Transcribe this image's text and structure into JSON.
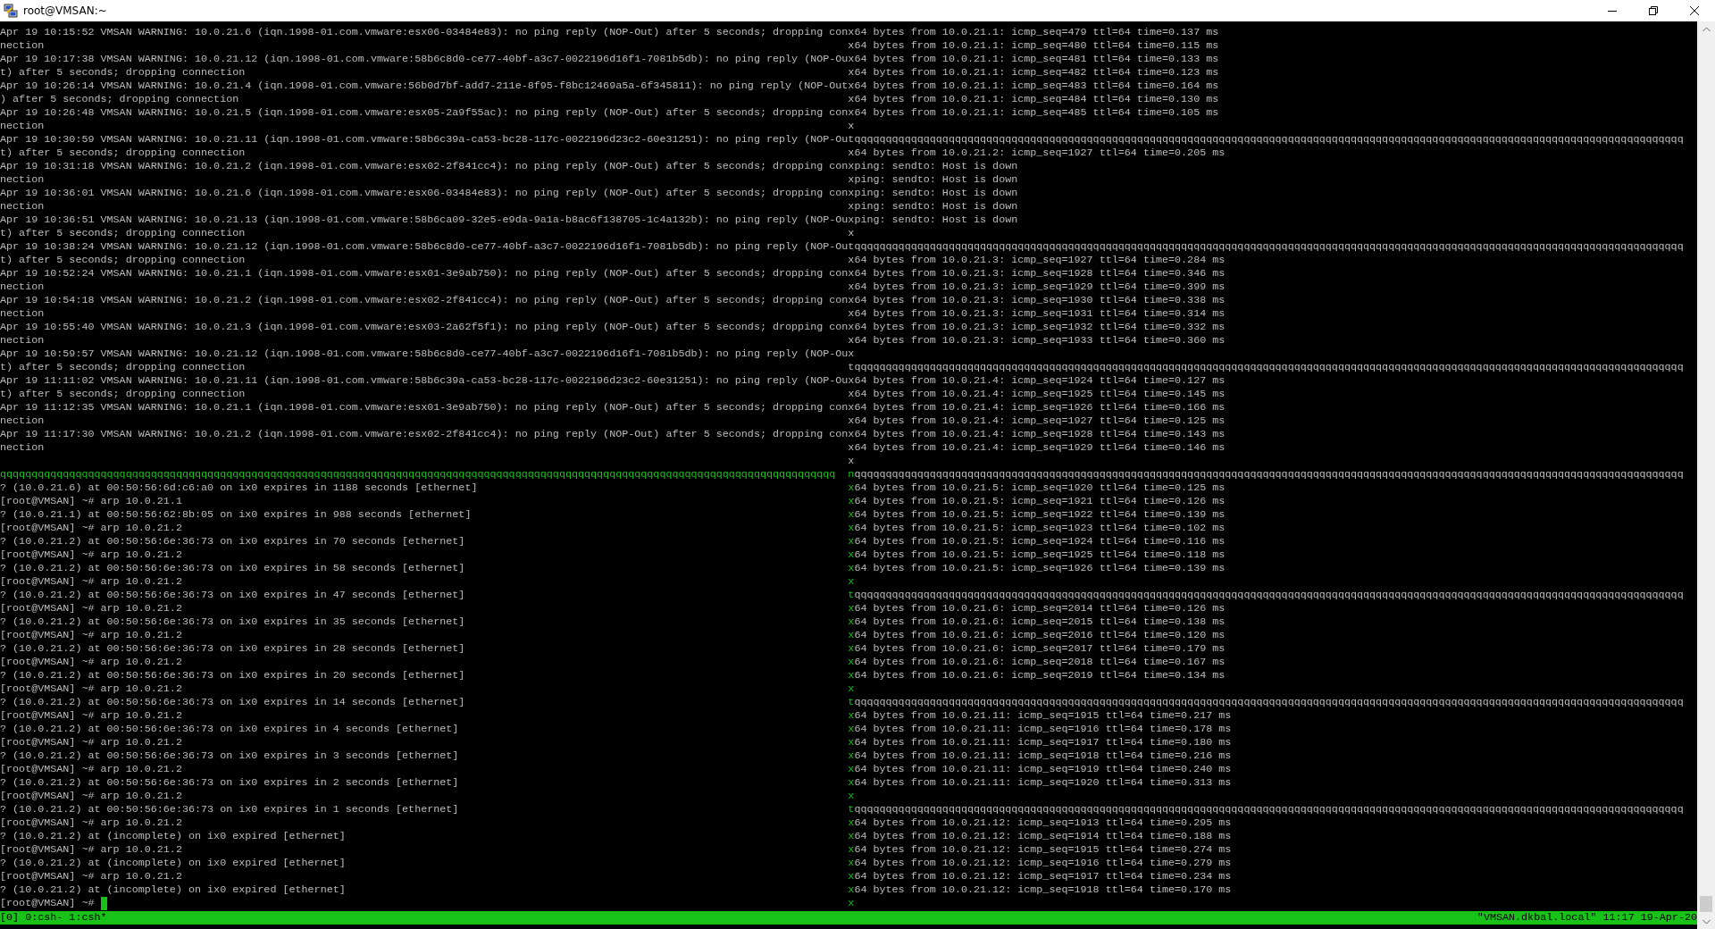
{
  "window": {
    "title": "root@VMSAN:~"
  },
  "terminal": {
    "upper_rows": {
      "active": false,
      "rows": [
        {
          "left": "Apr 19 10:15:52 VMSAN WARNING: 10.0.21.6 (iqn.1998-01.com.vmware:esx06-03484e83): no ping reply (NOP-Out) after 5 seconds; dropping con",
          "sep": "x",
          "right": "64 bytes from 10.0.21.1: icmp_seq=479 ttl=64 time=0.137 ms"
        },
        {
          "left": "nection",
          "sep": "x",
          "right": "64 bytes from 10.0.21.1: icmp_seq=480 ttl=64 time=0.115 ms"
        },
        {
          "left": "Apr 19 10:17:38 VMSAN WARNING: 10.0.21.12 (iqn.1998-01.com.vmware:58b6c8d0-ce77-40bf-a3c7-0022196d16f1-7081b5db): no ping reply (NOP-Ou",
          "sep": "x",
          "right": "64 bytes from 10.0.21.1: icmp_seq=481 ttl=64 time=0.133 ms"
        },
        {
          "left": "t) after 5 seconds; dropping connection",
          "sep": "x",
          "right": "64 bytes from 10.0.21.1: icmp_seq=482 ttl=64 time=0.123 ms"
        },
        {
          "left": "Apr 19 10:26:14 VMSAN WARNING: 10.0.21.4 (iqn.1998-01.com.vmware:56b0d7bf-add7-211e-8f95-f8bc12469a5a-6f345811): no ping reply (NOP-Out",
          "sep": "x",
          "right": "64 bytes from 10.0.21.1: icmp_seq=483 ttl=64 time=0.164 ms"
        },
        {
          "left": ") after 5 seconds; dropping connection",
          "sep": "x",
          "right": "64 bytes from 10.0.21.1: icmp_seq=484 ttl=64 time=0.130 ms"
        },
        {
          "left": "Apr 19 10:26:48 VMSAN WARNING: 10.0.21.5 (iqn.1998-01.com.vmware:esx05-2a9f55ac): no ping reply (NOP-Out) after 5 seconds; dropping con",
          "sep": "x",
          "right": "64 bytes from 10.0.21.1: icmp_seq=485 ttl=64 time=0.105 ms"
        },
        {
          "left": "nection",
          "sep": "x"
        },
        {
          "left": "Apr 19 10:30:59 VMSAN WARNING: 10.0.21.11 (iqn.1998-01.com.vmware:58b6c39a-ca53-bc28-117c-0022196d23c2-60e31251): no ping reply (NOP-Ou",
          "sep": "t",
          "right": "qqqqqqqqqqqqqqqqqqqqqqqqqqqqqqqqqqqqqqqqqqqqqqqqqqqqqqqqqqqqqqqqqqqqqqqqqqqqqqqqqqqqqqqqqqqqqqqqqqqqqqqqqqqqqqqqqqqqqqqqqqqqqqqqqqqq"
        },
        {
          "left": "t) after 5 seconds; dropping connection",
          "sep": "x",
          "right": "64 bytes from 10.0.21.2: icmp_seq=1927 ttl=64 time=0.205 ms"
        },
        {
          "left": "Apr 19 10:31:18 VMSAN WARNING: 10.0.21.2 (iqn.1998-01.com.vmware:esx02-2f841cc4): no ping reply (NOP-Out) after 5 seconds; dropping con",
          "sep": "x",
          "right": "ping: sendto: Host is down"
        },
        {
          "left": "nection",
          "sep": "x",
          "right": "ping: sendto: Host is down"
        },
        {
          "left": "Apr 19 10:36:01 VMSAN WARNING: 10.0.21.6 (iqn.1998-01.com.vmware:esx06-03484e83): no ping reply (NOP-Out) after 5 seconds; dropping con",
          "sep": "x",
          "right": "ping: sendto: Host is down"
        },
        {
          "left": "nection",
          "sep": "x",
          "right": "ping: sendto: Host is down"
        },
        {
          "left": "Apr 19 10:36:51 VMSAN WARNING: 10.0.21.13 (iqn.1998-01.com.vmware:58b6ca09-32e5-e9da-9a1a-b8ac6f138705-1c4a132b): no ping reply (NOP-Ou",
          "sep": "x",
          "right": "ping: sendto: Host is down"
        },
        {
          "left": "t) after 5 seconds; dropping connection",
          "sep": "x"
        },
        {
          "left": "Apr 19 10:38:24 VMSAN WARNING: 10.0.21.12 (iqn.1998-01.com.vmware:58b6c8d0-ce77-40bf-a3c7-0022196d16f1-7081b5db): no ping reply (NOP-Ou",
          "sep": "t",
          "right": "qqqqqqqqqqqqqqqqqqqqqqqqqqqqqqqqqqqqqqqqqqqqqqqqqqqqqqqqqqqqqqqqqqqqqqqqqqqqqqqqqqqqqqqqqqqqqqqqqqqqqqqqqqqqqqqqqqqqqqqqqqqqqqqqqqqq"
        },
        {
          "left": "t) after 5 seconds; dropping connection",
          "sep": "x",
          "right": "64 bytes from 10.0.21.3: icmp_seq=1927 ttl=64 time=0.284 ms"
        },
        {
          "left": "Apr 19 10:52:24 VMSAN WARNING: 10.0.21.1 (iqn.1998-01.com.vmware:esx01-3e9ab750): no ping reply (NOP-Out) after 5 seconds; dropping con",
          "sep": "x",
          "right": "64 bytes from 10.0.21.3: icmp_seq=1928 ttl=64 time=0.346 ms"
        },
        {
          "left": "nection",
          "sep": "x",
          "right": "64 bytes from 10.0.21.3: icmp_seq=1929 ttl=64 time=0.399 ms"
        },
        {
          "left": "Apr 19 10:54:18 VMSAN WARNING: 10.0.21.2 (iqn.1998-01.com.vmware:esx02-2f841cc4): no ping reply (NOP-Out) after 5 seconds; dropping con",
          "sep": "x",
          "right": "64 bytes from 10.0.21.3: icmp_seq=1930 ttl=64 time=0.338 ms"
        },
        {
          "left": "nection",
          "sep": "x",
          "right": "64 bytes from 10.0.21.3: icmp_seq=1931 ttl=64 time=0.314 ms"
        },
        {
          "left": "Apr 19 10:55:40 VMSAN WARNING: 10.0.21.3 (iqn.1998-01.com.vmware:esx03-2a62f5f1): no ping reply (NOP-Out) after 5 seconds; dropping con",
          "sep": "x",
          "right": "64 bytes from 10.0.21.3: icmp_seq=1932 ttl=64 time=0.332 ms"
        },
        {
          "left": "nection",
          "sep": "x",
          "right": "64 bytes from 10.0.21.3: icmp_seq=1933 ttl=64 time=0.360 ms"
        },
        {
          "left": "Apr 19 10:59:57 VMSAN WARNING: 10.0.21.12 (iqn.1998-01.com.vmware:58b6c8d0-ce77-40bf-a3c7-0022196d16f1-7081b5db): no ping reply (NOP-Ou",
          "sep": "x"
        },
        {
          "left": "t) after 5 seconds; dropping connection",
          "sep": "t",
          "right": "qqqqqqqqqqqqqqqqqqqqqqqqqqqqqqqqqqqqqqqqqqqqqqqqqqqqqqqqqqqqqqqqqqqqqqqqqqqqqqqqqqqqqqqqqqqqqqqqqqqqqqqqqqqqqqqqqqqqqqqqqqqqqqqqqqqq"
        },
        {
          "left": "Apr 19 11:11:02 VMSAN WARNING: 10.0.21.11 (iqn.1998-01.com.vmware:58b6c39a-ca53-bc28-117c-0022196d23c2-60e31251): no ping reply (NOP-Ou",
          "sep": "x",
          "right": "64 bytes from 10.0.21.4: icmp_seq=1924 ttl=64 time=0.127 ms"
        },
        {
          "left": "t) after 5 seconds; dropping connection",
          "sep": "x",
          "right": "64 bytes from 10.0.21.4: icmp_seq=1925 ttl=64 time=0.145 ms"
        },
        {
          "left": "Apr 19 11:12:35 VMSAN WARNING: 10.0.21.1 (iqn.1998-01.com.vmware:esx01-3e9ab750): no ping reply (NOP-Out) after 5 seconds; dropping con",
          "sep": "x",
          "right": "64 bytes from 10.0.21.4: icmp_seq=1926 ttl=64 time=0.166 ms"
        },
        {
          "left": "nection",
          "sep": "x",
          "right": "64 bytes from 10.0.21.4: icmp_seq=1927 ttl=64 time=0.125 ms"
        },
        {
          "left": "Apr 19 11:17:30 VMSAN WARNING: 10.0.21.2 (iqn.1998-01.com.vmware:esx02-2f841cc4): no ping reply (NOP-Out) after 5 seconds; dropping con",
          "sep": "x",
          "right": "64 bytes from 10.0.21.4: icmp_seq=1928 ttl=64 time=0.143 ms"
        },
        {
          "left": "nection",
          "sep": "x",
          "right": "64 bytes from 10.0.21.4: icmp_seq=1929 ttl=64 time=0.146 ms"
        },
        {
          "sep": "x"
        }
      ]
    },
    "divider": {
      "left": "qqqqqqqqqqqqqqqqqqqqqqqqqqqqqqqqqqqqqqqqqqqqqqqqqqqqqqqqqqqqqqqqqqqqqqqqqqqqqqqqqqqqqqqqqqqqqqqqqqqqqqqqqqqqqqqqqqqqqqqqqqqqqqqqqqqqq",
      "junction": "n",
      "right": "qqqqqqqqqqqqqqqqqqqqqqqqqqqqqqqqqqqqqqqqqqqqqqqqqqqqqqqqqqqqqqqqqqqqqqqqqqqqqqqqqqqqqqqqqqqqqqqqqqqqqqqqqqqqqqqqqqqqqqqqqqqqqqqqqqqq"
    },
    "lower_rows": {
      "active": true,
      "rows": [
        {
          "left": "? (10.0.21.6) at 00:50:56:6d:c6:a0 on ix0 expires in 1188 seconds [ethernet]",
          "sep": "x",
          "right": "64 bytes from 10.0.21.5: icmp_seq=1920 ttl=64 time=0.125 ms"
        },
        {
          "left": "[root@VMSAN] ~# arp 10.0.21.1",
          "sep": "x",
          "right": "64 bytes from 10.0.21.5: icmp_seq=1921 ttl=64 time=0.126 ms"
        },
        {
          "left": "? (10.0.21.1) at 00:50:56:62:8b:05 on ix0 expires in 988 seconds [ethernet]",
          "sep": "x",
          "right": "64 bytes from 10.0.21.5: icmp_seq=1922 ttl=64 time=0.139 ms"
        },
        {
          "left": "[root@VMSAN] ~# arp 10.0.21.2",
          "sep": "x",
          "right": "64 bytes from 10.0.21.5: icmp_seq=1923 ttl=64 time=0.102 ms"
        },
        {
          "left": "? (10.0.21.2) at 00:50:56:6e:36:73 on ix0 expires in 70 seconds [ethernet]",
          "sep": "x",
          "right": "64 bytes from 10.0.21.5: icmp_seq=1924 ttl=64 time=0.116 ms"
        },
        {
          "left": "[root@VMSAN] ~# arp 10.0.21.2",
          "sep": "x",
          "right": "64 bytes from 10.0.21.5: icmp_seq=1925 ttl=64 time=0.118 ms"
        },
        {
          "left": "? (10.0.21.2) at 00:50:56:6e:36:73 on ix0 expires in 58 seconds [ethernet]",
          "sep": "x",
          "right": "64 bytes from 10.0.21.5: icmp_seq=1926 ttl=64 time=0.139 ms"
        },
        {
          "left": "[root@VMSAN] ~# arp 10.0.21.2",
          "sep": "x"
        },
        {
          "left": "? (10.0.21.2) at 00:50:56:6e:36:73 on ix0 expires in 47 seconds [ethernet]",
          "sep": "t",
          "right": "qqqqqqqqqqqqqqqqqqqqqqqqqqqqqqqqqqqqqqqqqqqqqqqqqqqqqqqqqqqqqqqqqqqqqqqqqqqqqqqqqqqqqqqqqqqqqqqqqqqqqqqqqqqqqqqqqqqqqqqqqqqqqqqqqqqq"
        },
        {
          "left": "[root@VMSAN] ~# arp 10.0.21.2",
          "sep": "x",
          "right": "64 bytes from 10.0.21.6: icmp_seq=2014 ttl=64 time=0.126 ms"
        },
        {
          "left": "? (10.0.21.2) at 00:50:56:6e:36:73 on ix0 expires in 35 seconds [ethernet]",
          "sep": "x",
          "right": "64 bytes from 10.0.21.6: icmp_seq=2015 ttl=64 time=0.138 ms"
        },
        {
          "left": "[root@VMSAN] ~# arp 10.0.21.2",
          "sep": "x",
          "right": "64 bytes from 10.0.21.6: icmp_seq=2016 ttl=64 time=0.120 ms"
        },
        {
          "left": "? (10.0.21.2) at 00:50:56:6e:36:73 on ix0 expires in 28 seconds [ethernet]",
          "sep": "x",
          "right": "64 bytes from 10.0.21.6: icmp_seq=2017 ttl=64 time=0.179 ms"
        },
        {
          "left": "[root@VMSAN] ~# arp 10.0.21.2",
          "sep": "x",
          "right": "64 bytes from 10.0.21.6: icmp_seq=2018 ttl=64 time=0.167 ms"
        },
        {
          "left": "? (10.0.21.2) at 00:50:56:6e:36:73 on ix0 expires in 20 seconds [ethernet]",
          "sep": "x",
          "right": "64 bytes from 10.0.21.6: icmp_seq=2019 ttl=64 time=0.134 ms"
        },
        {
          "left": "[root@VMSAN] ~# arp 10.0.21.2",
          "sep": "x"
        },
        {
          "left": "? (10.0.21.2) at 00:50:56:6e:36:73 on ix0 expires in 14 seconds [ethernet]",
          "sep": "t",
          "right": "qqqqqqqqqqqqqqqqqqqqqqqqqqqqqqqqqqqqqqqqqqqqqqqqqqqqqqqqqqqqqqqqqqqqqqqqqqqqqqqqqqqqqqqqqqqqqqqqqqqqqqqqqqqqqqqqqqqqqqqqqqqqqqqqqqqq"
        },
        {
          "left": "[root@VMSAN] ~# arp 10.0.21.2",
          "sep": "x",
          "right": "64 bytes from 10.0.21.11: icmp_seq=1915 ttl=64 time=0.217 ms"
        },
        {
          "left": "? (10.0.21.2) at 00:50:56:6e:36:73 on ix0 expires in 4 seconds [ethernet]",
          "sep": "x",
          "right": "64 bytes from 10.0.21.11: icmp_seq=1916 ttl=64 time=0.178 ms"
        },
        {
          "left": "[root@VMSAN] ~# arp 10.0.21.2",
          "sep": "x",
          "right": "64 bytes from 10.0.21.11: icmp_seq=1917 ttl=64 time=0.180 ms"
        },
        {
          "left": "? (10.0.21.2) at 00:50:56:6e:36:73 on ix0 expires in 3 seconds [ethernet]",
          "sep": "x",
          "right": "64 bytes from 10.0.21.11: icmp_seq=1918 ttl=64 time=0.216 ms"
        },
        {
          "left": "[root@VMSAN] ~# arp 10.0.21.2",
          "sep": "x",
          "right": "64 bytes from 10.0.21.11: icmp_seq=1919 ttl=64 time=0.240 ms"
        },
        {
          "left": "? (10.0.21.2) at 00:50:56:6e:36:73 on ix0 expires in 2 seconds [ethernet]",
          "sep": "x",
          "right": "64 bytes from 10.0.21.11: icmp_seq=1920 ttl=64 time=0.313 ms"
        },
        {
          "left": "[root@VMSAN] ~# arp 10.0.21.2",
          "sep": "x"
        },
        {
          "left": "? (10.0.21.2) at 00:50:56:6e:36:73 on ix0 expires in 1 seconds [ethernet]",
          "sep": "t",
          "right": "qqqqqqqqqqqqqqqqqqqqqqqqqqqqqqqqqqqqqqqqqqqqqqqqqqqqqqqqqqqqqqqqqqqqqqqqqqqqqqqqqqqqqqqqqqqqqqqqqqqqqqqqqqqqqqqqqqqqqqqqqqqqqqqqqqqq"
        },
        {
          "left": "[root@VMSAN] ~# arp 10.0.21.2",
          "sep": "x",
          "right": "64 bytes from 10.0.21.12: icmp_seq=1913 ttl=64 time=0.295 ms"
        },
        {
          "left": "? (10.0.21.2) at (incomplete) on ix0 expired [ethernet]",
          "sep": "x",
          "right": "64 bytes from 10.0.21.12: icmp_seq=1914 ttl=64 time=0.188 ms"
        },
        {
          "left": "[root@VMSAN] ~# arp 10.0.21.2",
          "sep": "x",
          "right": "64 bytes from 10.0.21.12: icmp_seq=1915 ttl=64 time=0.274 ms"
        },
        {
          "left": "? (10.0.21.2) at (incomplete) on ix0 expired [ethernet]",
          "sep": "x",
          "right": "64 bytes from 10.0.21.12: icmp_seq=1916 ttl=64 time=0.279 ms"
        },
        {
          "left": "[root@VMSAN] ~# arp 10.0.21.2",
          "sep": "x",
          "right": "64 bytes from 10.0.21.12: icmp_seq=1917 ttl=64 time=0.234 ms"
        },
        {
          "left": "? (10.0.21.2) at (incomplete) on ix0 expired [ethernet]",
          "sep": "x",
          "right": "64 bytes from 10.0.21.12: icmp_seq=1918 ttl=64 time=0.170 ms"
        },
        {
          "left": "[root@VMSAN] ~#",
          "sep": "x",
          "cursor": true
        }
      ]
    }
  },
  "status_bar": {
    "left": "[0] 0:csh- 1:csh*",
    "right": "\"VMSAN.dkbal.local\" 11:17 19-Apr-20"
  }
}
